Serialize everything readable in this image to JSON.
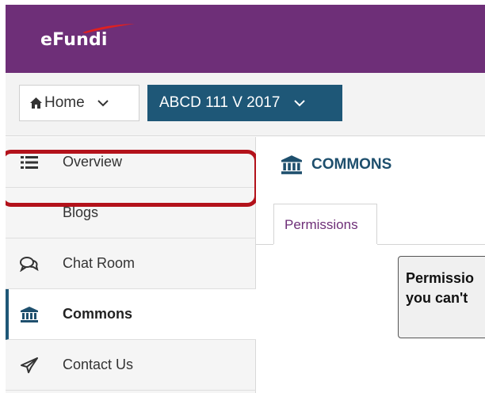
{
  "header": {
    "logo_text": "eFundi",
    "brand_color": "#6e2f78",
    "swoosh_color": "#e02020"
  },
  "nav": {
    "home_label": "Home",
    "home_icon": "home-icon",
    "site_label": "ABCD 111 V 2017",
    "site_color": "#1e5777"
  },
  "sidebar": {
    "items": [
      {
        "label": "Overview",
        "icon": "list-icon"
      },
      {
        "label": "Blogs",
        "icon": ""
      },
      {
        "label": "Chat Room",
        "icon": "chat-icon"
      },
      {
        "label": "Commons",
        "icon": "institution-icon",
        "active": true
      },
      {
        "label": "Contact Us",
        "icon": "paper-plane-icon"
      }
    ]
  },
  "main": {
    "tool_title": "COMMONS",
    "tabs": [
      {
        "label": "Permissions"
      }
    ],
    "alert_line1": "Permissio",
    "alert_line2": "you can't"
  },
  "annotation": {
    "highlight_color": "#b3121b"
  }
}
